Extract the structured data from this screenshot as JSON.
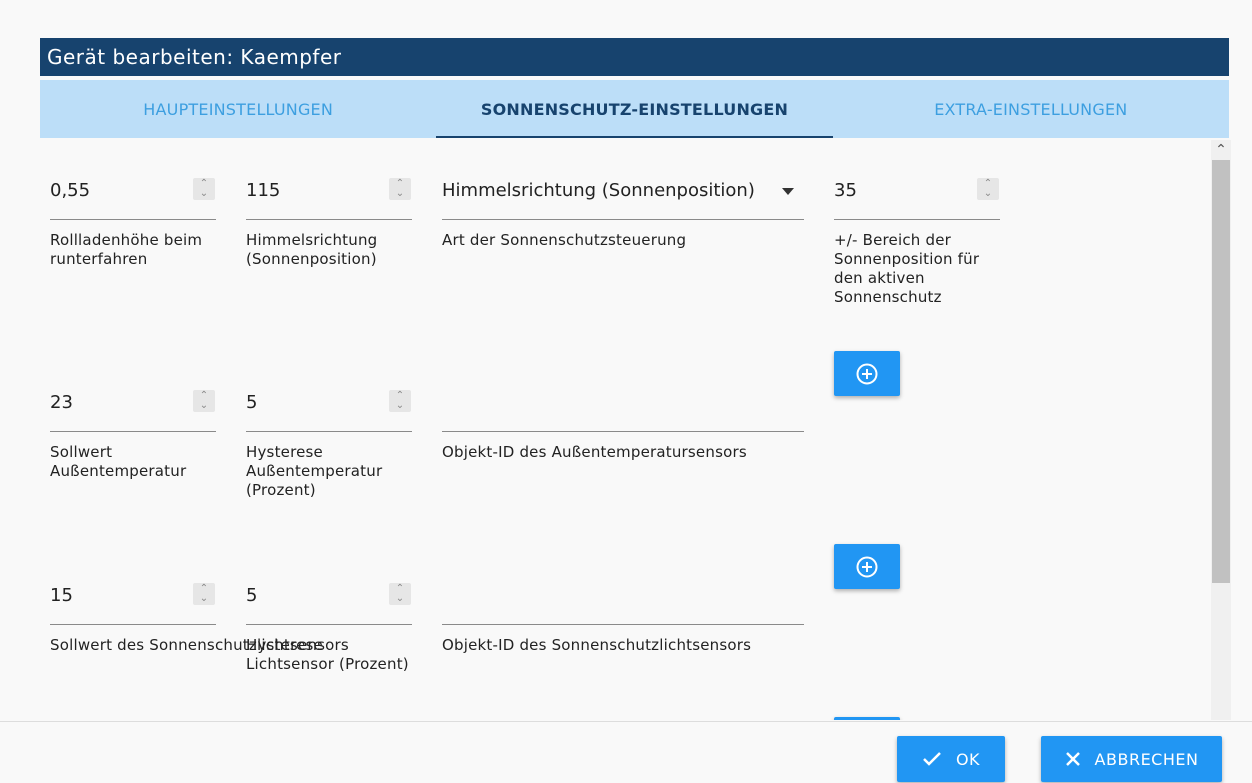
{
  "dialog": {
    "title": "Gerät bearbeiten: Kaempfer"
  },
  "tabs": [
    {
      "label": "HAUPTEINSTELLUNGEN"
    },
    {
      "label": "SONNENSCHUTZ-EINSTELLUNGEN"
    },
    {
      "label": "EXTRA-EINSTELLUNGEN"
    }
  ],
  "active_tab": "SONNENSCHUTZ-EINSTELLUNGEN",
  "row1": {
    "rollo_height": {
      "value": "0,55",
      "label": "Rollladenhöhe beim runterfahren"
    },
    "direction": {
      "value": "115",
      "label": "Himmelsrichtung (Sonnenposition)"
    },
    "control_type": {
      "value": "Himmelsrichtung (Sonnenposition)",
      "label": "Art der Sonnenschutzsteuerung"
    },
    "range": {
      "value": "35",
      "label": "+/- Bereich der Sonnenposition für den aktiven Sonnenschutz"
    }
  },
  "row2": {
    "temp_setpoint": {
      "value": "23",
      "label": "Sollwert Außentemperatur"
    },
    "temp_hysteresis": {
      "value": "5",
      "label": "Hysterese Außentemperatur (Prozent)"
    },
    "temp_sensor_id": {
      "value": "",
      "label": "Objekt-ID des Außentemperatursensors"
    }
  },
  "row3": {
    "light_setpoint": {
      "value": "15",
      "label": "Sollwert des Sonnenschutzlichtsensors"
    },
    "light_hysteresis": {
      "value": "5",
      "label": "Hysterese Lichtsensor (Prozent)"
    },
    "light_sensor_id": {
      "value": "",
      "label": "Objekt-ID des Sonnenschutzlichtsensors"
    }
  },
  "footer": {
    "ok_label": "OK",
    "cancel_label": "ABBRECHEN"
  },
  "icons": {
    "add": "plus-circle-icon",
    "ok": "check-icon",
    "cancel": "close-icon",
    "spin": "spinner-icon",
    "dropdown": "dropdown-arrow-icon"
  },
  "colors": {
    "title_bar": "#17436e",
    "tab_bar": "#bcdef8",
    "tab_inactive": "#3d9fe0",
    "button": "#2196f3"
  }
}
